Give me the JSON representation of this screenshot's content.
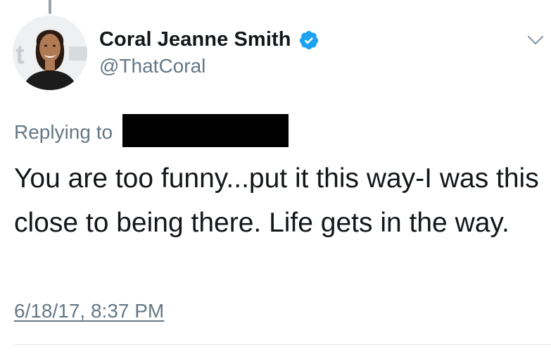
{
  "tweet": {
    "author": {
      "display_name": "Coral Jeanne Smith",
      "handle": "@ThatCoral",
      "verified": true
    },
    "reply": {
      "label": "Replying to",
      "recipient_redacted": true
    },
    "text": "You are too funny...put it this way-I was this close to being there. Life gets in the way.",
    "timestamp": "6/18/17, 8:37 PM"
  },
  "colors": {
    "primary_text": "#14171a",
    "secondary_text": "#657786",
    "verified_blue": "#1da1f2",
    "divider": "#e1e8ed"
  },
  "icons": {
    "verified": "verified-badge-icon",
    "menu": "chevron-down-icon"
  }
}
